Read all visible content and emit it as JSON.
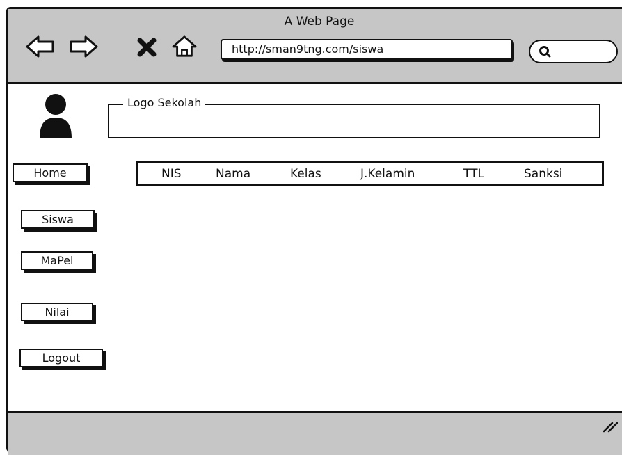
{
  "window": {
    "title": "A Web Page"
  },
  "toolbar": {
    "back_icon": "back-arrow-icon",
    "forward_icon": "forward-arrow-icon",
    "stop_icon": "close-icon",
    "home_icon": "home-icon",
    "url": "http://sman9tng.com/siswa",
    "search_icon": "search-icon"
  },
  "header": {
    "avatar_icon": "user-icon",
    "logo_label": "Logo Sekolah"
  },
  "sidebar": {
    "items": [
      {
        "label": "Home"
      },
      {
        "label": "Siswa"
      },
      {
        "label": "MaPel"
      },
      {
        "label": "Nilai"
      },
      {
        "label": "Logout"
      }
    ]
  },
  "table": {
    "columns": [
      "NIS",
      "Nama",
      "Kelas",
      "J.Kelamin",
      "TTL",
      "Sanksi"
    ]
  },
  "colors": {
    "chrome": "#c6c6c6",
    "ink": "#111111",
    "background": "#ffffff"
  }
}
